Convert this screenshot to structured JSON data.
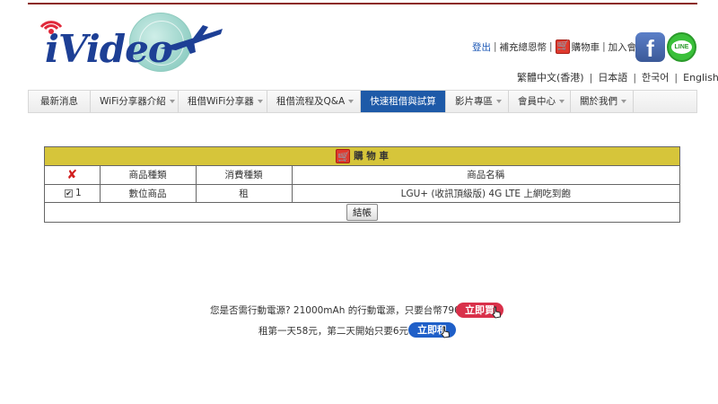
{
  "brand": {
    "name": "iVideo"
  },
  "top_links": {
    "logout": "登出",
    "add_thanks": "補充總恩幣",
    "cart": "購物車",
    "join": "加入會員"
  },
  "social": {
    "facebook": "f",
    "line": "LINE"
  },
  "languages": [
    "繁體中文(香港)",
    "日本語",
    "한국어",
    "English"
  ],
  "nav": {
    "items": [
      {
        "label": "最新消息",
        "caret": false,
        "active": false
      },
      {
        "label": "WiFi分享器介紹",
        "caret": true,
        "active": false
      },
      {
        "label": "租借WiFi分享器",
        "caret": true,
        "active": false
      },
      {
        "label": "租借流程及Q&A",
        "caret": true,
        "active": false
      },
      {
        "label": "快速租借與試算",
        "caret": false,
        "active": true
      },
      {
        "label": "影片專區",
        "caret": true,
        "active": false
      },
      {
        "label": "會員中心",
        "caret": true,
        "active": false
      },
      {
        "label": "關於我們",
        "caret": true,
        "active": false
      }
    ]
  },
  "cart": {
    "title": "購 物 車",
    "columns": [
      "商品種類",
      "消費種類",
      "商品名稱"
    ],
    "rows": [
      {
        "index": "1",
        "checked": true,
        "category": "數位商品",
        "type": "租",
        "name": "LGU+ (收訊頂級版) 4G LTE 上網吃到飽"
      }
    ],
    "checkout_label": "結帳",
    "colors": {
      "header": "#d6c53a"
    }
  },
  "promo": {
    "line1": "您是否需行動電源? 21000mAh 的行動電源，只要台幣790，",
    "buy_label": "立即買",
    "line2": "租第一天58元，第二天開始只要6元.",
    "rent_label": "立即租",
    "colors": {
      "buy": "#d9304a",
      "rent": "#1f5fc8"
    }
  }
}
